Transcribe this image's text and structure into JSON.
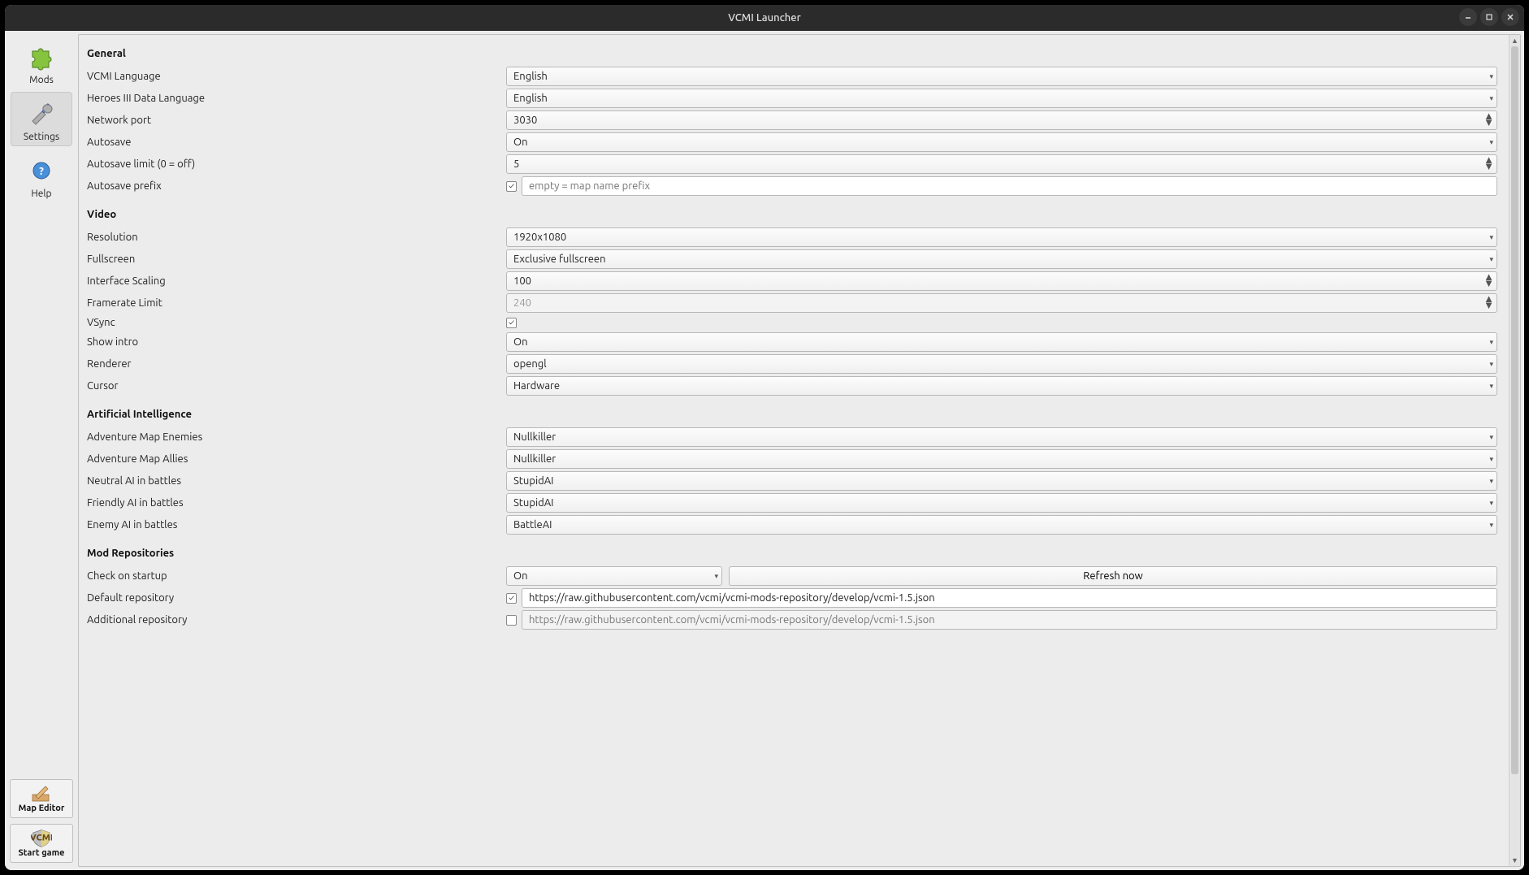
{
  "window": {
    "title": "VCMI Launcher"
  },
  "sidebar": {
    "mods": "Mods",
    "settings": "Settings",
    "help": "Help",
    "map_editor": "Map Editor",
    "start_game": "Start game"
  },
  "sections": {
    "general": "General",
    "video": "Video",
    "ai": "Artificial Intelligence",
    "repos": "Mod Repositories"
  },
  "general": {
    "vcmi_lang_label": "VCMI Language",
    "vcmi_lang_value": "English",
    "h3_lang_label": "Heroes III Data Language",
    "h3_lang_value": "English",
    "net_port_label": "Network port",
    "net_port_value": "3030",
    "autosave_label": "Autosave",
    "autosave_value": "On",
    "autosave_limit_label": "Autosave limit (0 = off)",
    "autosave_limit_value": "5",
    "autosave_prefix_label": "Autosave prefix",
    "autosave_prefix_placeholder": "empty = map name prefix"
  },
  "video": {
    "resolution_label": "Resolution",
    "resolution_value": "1920x1080",
    "fullscreen_label": "Fullscreen",
    "fullscreen_value": "Exclusive fullscreen",
    "scaling_label": "Interface Scaling",
    "scaling_value": "100",
    "fps_label": "Framerate Limit",
    "fps_value": "240",
    "vsync_label": "VSync",
    "intro_label": "Show intro",
    "intro_value": "On",
    "renderer_label": "Renderer",
    "renderer_value": "opengl",
    "cursor_label": "Cursor",
    "cursor_value": "Hardware"
  },
  "ai": {
    "adv_enemies_label": "Adventure Map Enemies",
    "adv_enemies_value": "Nullkiller",
    "adv_allies_label": "Adventure Map Allies",
    "adv_allies_value": "Nullkiller",
    "neutral_label": "Neutral AI in battles",
    "neutral_value": "StupidAI",
    "friendly_label": "Friendly AI in battles",
    "friendly_value": "StupidAI",
    "enemy_label": "Enemy AI in battles",
    "enemy_value": "BattleAI"
  },
  "repos": {
    "check_label": "Check on startup",
    "check_value": "On",
    "refresh_label": "Refresh now",
    "default_label": "Default repository",
    "default_value": "https://raw.githubusercontent.com/vcmi/vcmi-mods-repository/develop/vcmi-1.5.json",
    "additional_label": "Additional repository",
    "additional_placeholder": "https://raw.githubusercontent.com/vcmi/vcmi-mods-repository/develop/vcmi-1.5.json"
  }
}
